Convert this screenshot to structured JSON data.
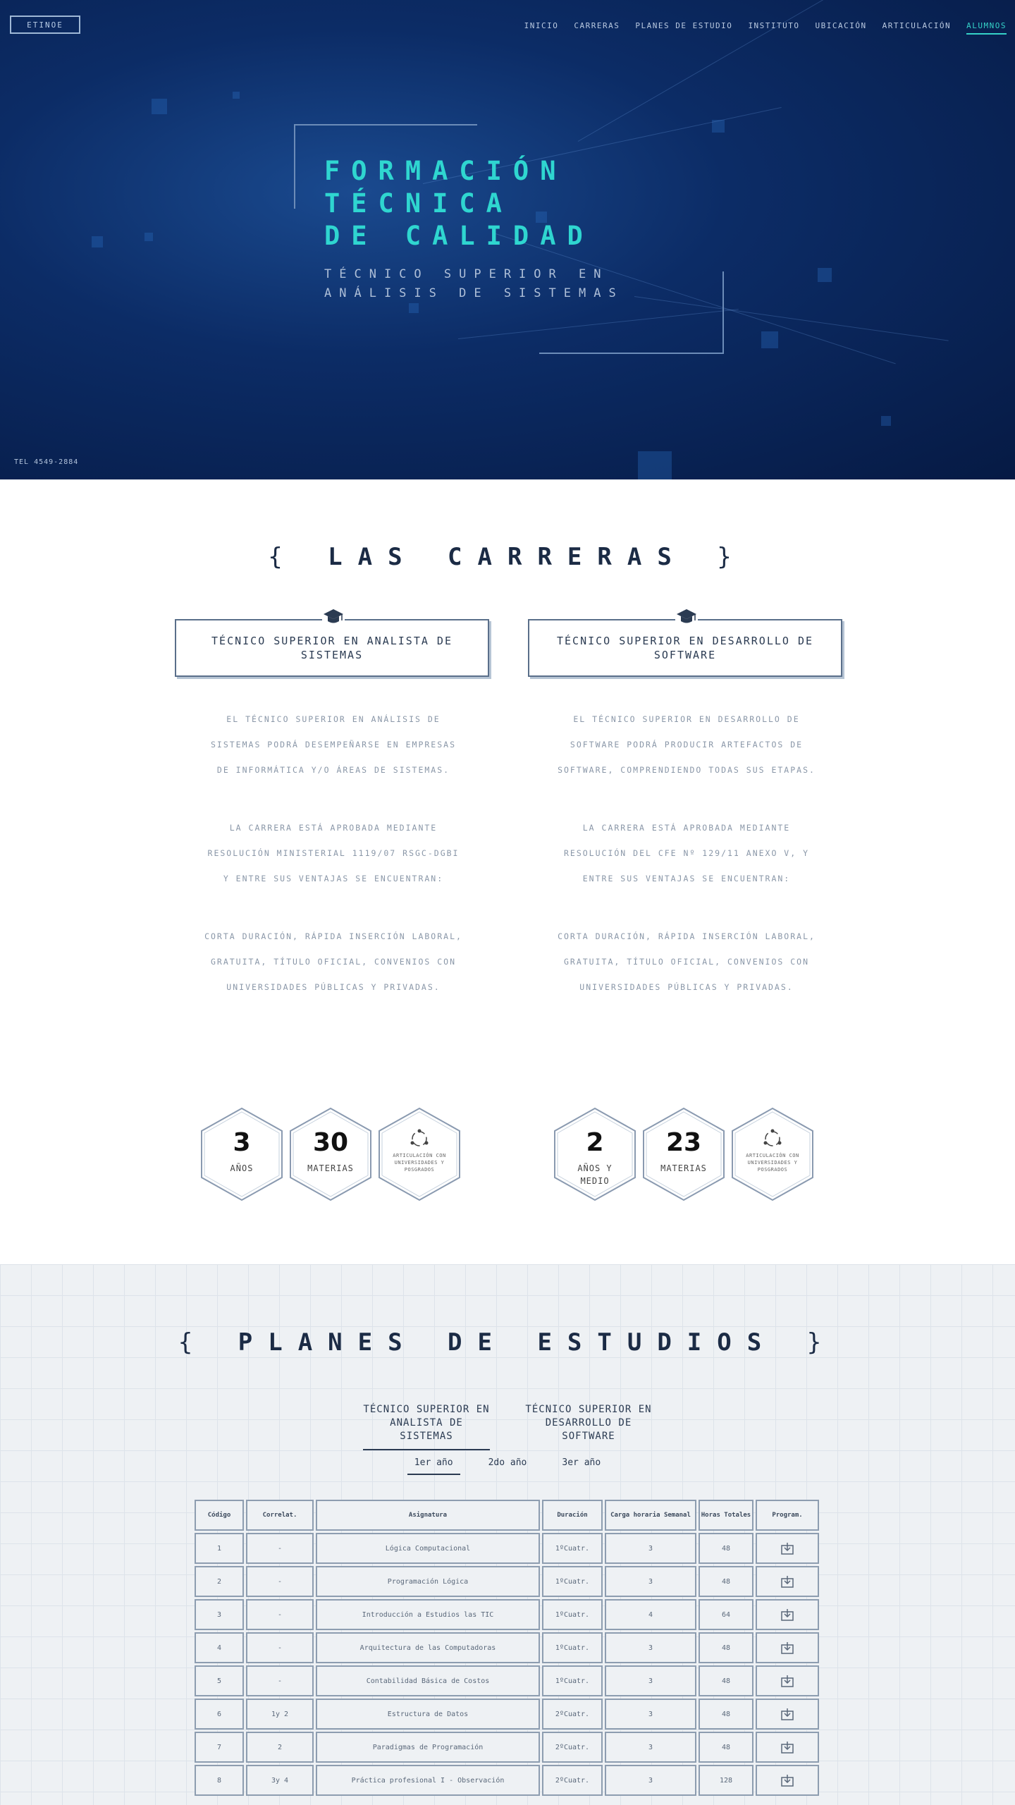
{
  "nav": {
    "logo": "ETINOE",
    "items": [
      "Inicio",
      "Carreras",
      "Planes de estudio",
      "Instituto",
      "Ubicación",
      "Articulación",
      "Alumnos"
    ],
    "active_index": 6
  },
  "hero": {
    "title_lines": [
      "FORMACIÓN",
      "TÉCNICA",
      "DE CALIDAD"
    ],
    "subtitle": "TÉCNICO SUPERIOR EN ANÁLISIS DE SISTEMAS",
    "phone": "TEL 4549-2884",
    "accent": "#2fd6d0"
  },
  "carreras": {
    "title": "LAS CARRERAS",
    "bracket_left": "{",
    "bracket_right": "}",
    "items": [
      {
        "icon": "graduation-cap-icon",
        "title": "TÉCNICO SUPERIOR EN ANALISTA DE SISTEMAS",
        "paragraphs": [
          "El Técnico Superior en Análisis de Sistemas podrá desempeñarse en empresas de informática y/o áreas de sistemas.",
          "La carrera está aprobada mediante Resolución Ministerial 1119/07 RSGC-DGBI y entre sus ventajas se encuentran:",
          "Corta duración, rápida inserción laboral, gratuita, título oficial, convenios con universidades públicas y privadas."
        ],
        "stats": [
          {
            "number": "3",
            "label": "AÑOS"
          },
          {
            "number": "30",
            "label": "MATERIAS"
          },
          {
            "icon": "articulation-icon",
            "label": "ARTICULACIÓN CON UNIVERSIDADES Y POSGRADOS"
          }
        ]
      },
      {
        "icon": "graduation-cap-icon",
        "title": "TÉCNICO SUPERIOR EN DESARROLLO DE SOFTWARE",
        "paragraphs": [
          "El Técnico Superior en Desarrollo de Software podrá producir artefactos de software, comprendiendo todas sus etapas.",
          "La carrera está aprobada mediante Resolución del CFE Nº 129/11 Anexo V, y entre sus ventajas se encuentran:",
          "Corta duración, rápida inserción laboral, gratuita, título oficial, convenios con universidades públicas y privadas."
        ],
        "stats": [
          {
            "number": "2",
            "label": "AÑOS Y MEDIO"
          },
          {
            "number": "23",
            "label": "MATERIAS"
          },
          {
            "icon": "articulation-icon",
            "label": "ARTICULACIÓN CON UNIVERSIDADES Y POSGRADOS"
          }
        ]
      }
    ]
  },
  "planes": {
    "title": "PLANES DE ESTUDIOS",
    "bracket_left": "{",
    "bracket_right": "}",
    "career_tabs": [
      "TÉCNICO SUPERIOR EN ANALISTA DE SISTEMAS",
      "TÉCNICO SUPERIOR EN DESARROLLO DE SOFTWARE"
    ],
    "career_tab_active": 0,
    "year_tabs": [
      "1er año",
      "2do año",
      "3er año"
    ],
    "year_tab_active": 0,
    "table": {
      "headers": [
        "Código",
        "Correlat.",
        "Asignatura",
        "Duración",
        "Carga horaria Semanal",
        "Horas Totales",
        "Program."
      ],
      "rows": [
        [
          "1",
          "-",
          "Lógica Computacional",
          "1ºCuatr.",
          "3",
          "48",
          "download-icon"
        ],
        [
          "2",
          "-",
          "Programación Lógica",
          "1ºCuatr.",
          "3",
          "48",
          "download-icon"
        ],
        [
          "3",
          "-",
          "Introducción a Estudios las TIC",
          "1ºCuatr.",
          "4",
          "64",
          "download-icon"
        ],
        [
          "4",
          "-",
          "Arquitectura de las Computadoras",
          "1ºCuatr.",
          "3",
          "48",
          "download-icon"
        ],
        [
          "5",
          "-",
          "Contabilidad Básica de Costos",
          "1ºCuatr.",
          "3",
          "48",
          "download-icon"
        ],
        [
          "6",
          "1y 2",
          "Estructura de Datos",
          "2ºCuatr.",
          "3",
          "48",
          "download-icon"
        ],
        [
          "7",
          "2",
          "Paradigmas de Programación",
          "2ºCuatr.",
          "3",
          "48",
          "download-icon"
        ],
        [
          "8",
          "3y 4",
          "Práctica profesional I - Observación",
          "2ºCuatr.",
          "3",
          "128",
          "download-icon"
        ]
      ]
    }
  }
}
